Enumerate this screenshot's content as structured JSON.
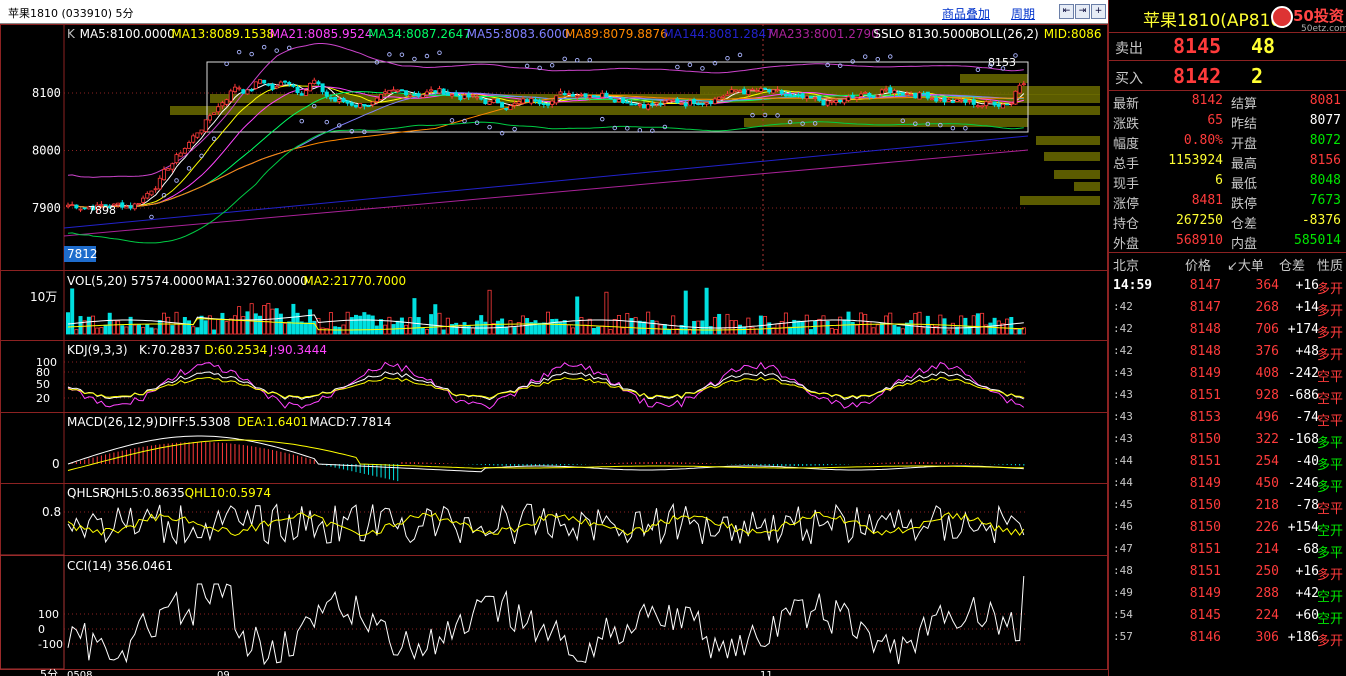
{
  "toolbar": {
    "title": "苹果1810 (033910) 5分",
    "overlay_link": "商品叠加",
    "period_link": "周期"
  },
  "main_panel": {
    "indicators": [
      {
        "text": "K",
        "color": "#c0c0c0"
      },
      {
        "text": "MA5:8100.0000",
        "color": "#ffffff"
      },
      {
        "text": "MA13:8089.1538",
        "color": "#ffff00"
      },
      {
        "text": "MA21:8085.9524",
        "color": "#ff44ff"
      },
      {
        "text": "MA34:8087.2647",
        "color": "#00ff66"
      },
      {
        "text": "MA55:8083.6000",
        "color": "#8080ff"
      },
      {
        "text": "MA89:8079.8876",
        "color": "#ff8800"
      },
      {
        "text": "MA144:8081.2847",
        "color": "#2222cc"
      },
      {
        "text": "MA233:8001.2790",
        "color": "#aa2299"
      },
      {
        "text": "SSLO 8130.5000",
        "color": "#ffffff"
      },
      {
        "text": "BOLL(26,2)",
        "color": "#ffffff"
      },
      {
        "text": "MID:8086",
        "color": "#ffff00"
      }
    ],
    "y_ticks": [
      "8100",
      "8000",
      "7900"
    ],
    "low_label": "7812",
    "low_mark": "7898",
    "box_high_label": "8153"
  },
  "vol_panel": {
    "indicators": [
      {
        "text": "VOL(5,20) 57574.0000",
        "color": "#ffffff"
      },
      {
        "text": "MA1:32760.0000",
        "color": "#ffffff"
      },
      {
        "text": "MA2:21770.7000",
        "color": "#ffff00"
      }
    ],
    "y_tick": "10万"
  },
  "kdj_panel": {
    "indicators": [
      {
        "text": "KDJ(9,3,3)",
        "color": "#ffffff"
      },
      {
        "text": "K:70.2837",
        "color": "#ffffff"
      },
      {
        "text": "D:60.2534",
        "color": "#ffff00"
      },
      {
        "text": "J:90.3444",
        "color": "#ff44ff"
      }
    ],
    "y_ticks": [
      "100",
      "80",
      "50",
      "20"
    ]
  },
  "macd_panel": {
    "indicators": [
      {
        "text": "MACD(26,12,9)",
        "color": "#ffffff"
      },
      {
        "text": "DIFF:5.5308",
        "color": "#ffffff"
      },
      {
        "text": "DEA:1.6401",
        "color": "#ffff00"
      },
      {
        "text": "MACD:7.7814",
        "color": "#ffffff"
      }
    ],
    "y_tick": "0"
  },
  "qhlsr_panel": {
    "indicators": [
      {
        "text": "QHLSR",
        "color": "#ffffff"
      },
      {
        "text": "QHL5:0.8635",
        "color": "#ffffff"
      },
      {
        "text": "QHL10:0.5974",
        "color": "#ffff00"
      }
    ],
    "y_tick": "0.8"
  },
  "cci_panel": {
    "indicators": [
      {
        "text": "CCI(14) 356.0461",
        "color": "#ffffff"
      }
    ],
    "y_ticks": [
      "100",
      "0",
      "-100"
    ]
  },
  "x_axis": {
    "corner": "5分",
    "labels": [
      "0508",
      "09",
      "11"
    ]
  },
  "quote": {
    "title": "苹果1810(AP810)",
    "logo_text": "50投资",
    "logo_sub": "50etz.com",
    "sell_label": "卖出",
    "sell_price": "8145",
    "sell_vol": "48",
    "buy_label": "买入",
    "buy_price": "8142",
    "buy_vol": "2",
    "stats": [
      {
        "l1": "最新",
        "v1": "8142",
        "c1": "#ff3b3b",
        "l2": "结算",
        "v2": "8081",
        "c2": "#ff3b3b"
      },
      {
        "l1": "涨跌",
        "v1": "65",
        "c1": "#ff3b3b",
        "l2": "昨结",
        "v2": "8077",
        "c2": "#ffffff"
      },
      {
        "l1": "幅度",
        "v1": "0.80%",
        "c1": "#ff3b3b",
        "l2": "开盘",
        "v2": "8072",
        "c2": "#00e600"
      },
      {
        "l1": "总手",
        "v1": "1153924",
        "c1": "#ffff33",
        "l2": "最高",
        "v2": "8156",
        "c2": "#ff3b3b"
      },
      {
        "l1": "现手",
        "v1": "6",
        "c1": "#ffff33",
        "l2": "最低",
        "v2": "8048",
        "c2": "#00e600"
      },
      {
        "l1": "涨停",
        "v1": "8481",
        "c1": "#ff3b3b",
        "l2": "跌停",
        "v2": "7673",
        "c2": "#00e600"
      },
      {
        "l1": "持仓",
        "v1": "267250",
        "c1": "#ffff33",
        "l2": "仓差",
        "v2": "-8376",
        "c2": "#ffff33"
      },
      {
        "l1": "外盘",
        "v1": "568910",
        "c1": "#ff3b3b",
        "l2": "内盘",
        "v2": "585014",
        "c2": "#00e600"
      }
    ],
    "tick_header": {
      "loc": "北京",
      "price": "价格",
      "big": "↙大单",
      "pos": "仓差",
      "nature": "性质"
    },
    "ticks": [
      {
        "time": "14:59",
        "price": "8147",
        "vol": "364",
        "diff": "+16",
        "nature": "多开",
        "nc": "#ff3b3b"
      },
      {
        "time": ":42",
        "price": "8147",
        "vol": "268",
        "diff": "+14",
        "nature": "多开",
        "nc": "#ff3b3b"
      },
      {
        "time": ":42",
        "price": "8148",
        "vol": "706",
        "diff": "+174",
        "nature": "多开",
        "nc": "#ff3b3b"
      },
      {
        "time": ":42",
        "price": "8148",
        "vol": "376",
        "diff": "+48",
        "nature": "多开",
        "nc": "#ff3b3b"
      },
      {
        "time": ":43",
        "price": "8149",
        "vol": "408",
        "diff": "-242",
        "nature": "空平",
        "nc": "#ff3b3b"
      },
      {
        "time": ":43",
        "price": "8151",
        "vol": "928",
        "diff": "-686",
        "nature": "空平",
        "nc": "#ff3b3b"
      },
      {
        "time": ":43",
        "price": "8153",
        "vol": "496",
        "diff": "-74",
        "nature": "空平",
        "nc": "#ff3b3b"
      },
      {
        "time": ":43",
        "price": "8150",
        "vol": "322",
        "diff": "-168",
        "nature": "多平",
        "nc": "#00e600"
      },
      {
        "time": ":44",
        "price": "8151",
        "vol": "254",
        "diff": "-40",
        "nature": "多平",
        "nc": "#00e600"
      },
      {
        "time": ":44",
        "price": "8149",
        "vol": "450",
        "diff": "-246",
        "nature": "多平",
        "nc": "#00e600"
      },
      {
        "time": ":45",
        "price": "8150",
        "vol": "218",
        "diff": "-78",
        "nature": "空平",
        "nc": "#ff3b3b"
      },
      {
        "time": ":46",
        "price": "8150",
        "vol": "226",
        "diff": "+154",
        "nature": "空开",
        "nc": "#00e600"
      },
      {
        "time": ":47",
        "price": "8151",
        "vol": "214",
        "diff": "-68",
        "nature": "多平",
        "nc": "#00e600"
      },
      {
        "time": ":48",
        "price": "8151",
        "vol": "250",
        "diff": "+16",
        "nature": "多开",
        "nc": "#ff3b3b"
      },
      {
        "time": ":49",
        "price": "8149",
        "vol": "288",
        "diff": "+42",
        "nature": "空开",
        "nc": "#00e600"
      },
      {
        "time": ":54",
        "price": "8145",
        "vol": "224",
        "diff": "+60",
        "nature": "空开",
        "nc": "#00e600"
      },
      {
        "time": ":57",
        "price": "8146",
        "vol": "306",
        "diff": "+186",
        "nature": "多开",
        "nc": "#ff3b3b"
      }
    ]
  },
  "colors": {
    "up": "#ff3b3b",
    "down": "#00e0e0",
    "grid": "#8c2222",
    "profile": "#6b6b00"
  }
}
